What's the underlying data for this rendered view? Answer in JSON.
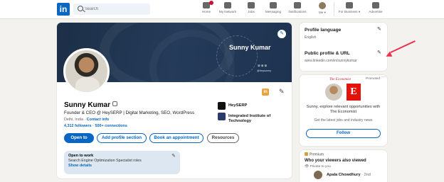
{
  "nav": {
    "logo": "in",
    "search_placeholder": "Search",
    "items": [
      {
        "label": "Home",
        "icon": "home-icon",
        "badge": true
      },
      {
        "label": "My Network",
        "icon": "network-icon",
        "badge": false
      },
      {
        "label": "Jobs",
        "icon": "jobs-icon",
        "badge": false
      },
      {
        "label": "Messaging",
        "icon": "messaging-icon",
        "badge": false
      },
      {
        "label": "Notifications",
        "icon": "bell-icon",
        "badge": false
      },
      {
        "label": "Me ▾",
        "icon": "avatar",
        "badge": false
      },
      {
        "label": "For Business ▾",
        "icon": "grid-icon",
        "badge": false
      },
      {
        "label": "Advertise",
        "icon": "advertise-icon",
        "badge": false
      }
    ]
  },
  "profile": {
    "banner_name": "Sunny Kumar",
    "banner_social": "⊚⊚⊚",
    "banner_handle": "@heysunny",
    "name": "Sunny Kumar",
    "headline": "Founder & CEO @ HeySERP | Digital Marketing, SEO, WordPress",
    "location": "Delhi, India · ",
    "contact_link": "Contact info",
    "followers": "4,312 followers",
    "connections": " · 500+ connections",
    "buttons": {
      "open_to": "Open to",
      "add_section": "Add profile section",
      "book": "Book an appointment",
      "resources": "Resources"
    },
    "companies": [
      {
        "name": "HeySERP",
        "color": "#111111"
      },
      {
        "name": "Integrated Institute of Technology",
        "color": "#2b3a6b"
      }
    ],
    "open_to_work": {
      "title": "Open to work",
      "roles": "Search Engine Optimization Specialist roles",
      "link": "Show details"
    }
  },
  "right": {
    "lang_title": "Profile language",
    "lang_value": "English",
    "url_title": "Public profile & URL",
    "url_value": "www.linkedin.com/in/sunnykumar"
  },
  "ad": {
    "brand": "The Economist",
    "promoted": "Promoted",
    "dots": "···",
    "logo": "E",
    "text": "Sunny, explore relevant opportunities with The Economist",
    "sub": "Get the latest jobs and industry news",
    "button": "Follow"
  },
  "premium": {
    "label": "Premium",
    "title": "Who your viewers also viewed",
    "privacy": "Private to you",
    "viewer_name": "Apala Chowdhury",
    "viewer_degree": " · 2nd"
  },
  "colors": {
    "accent": "#0a66c2",
    "banner": "#1d2f47",
    "annotation": "#e8344e",
    "economist": "#e3120b"
  }
}
